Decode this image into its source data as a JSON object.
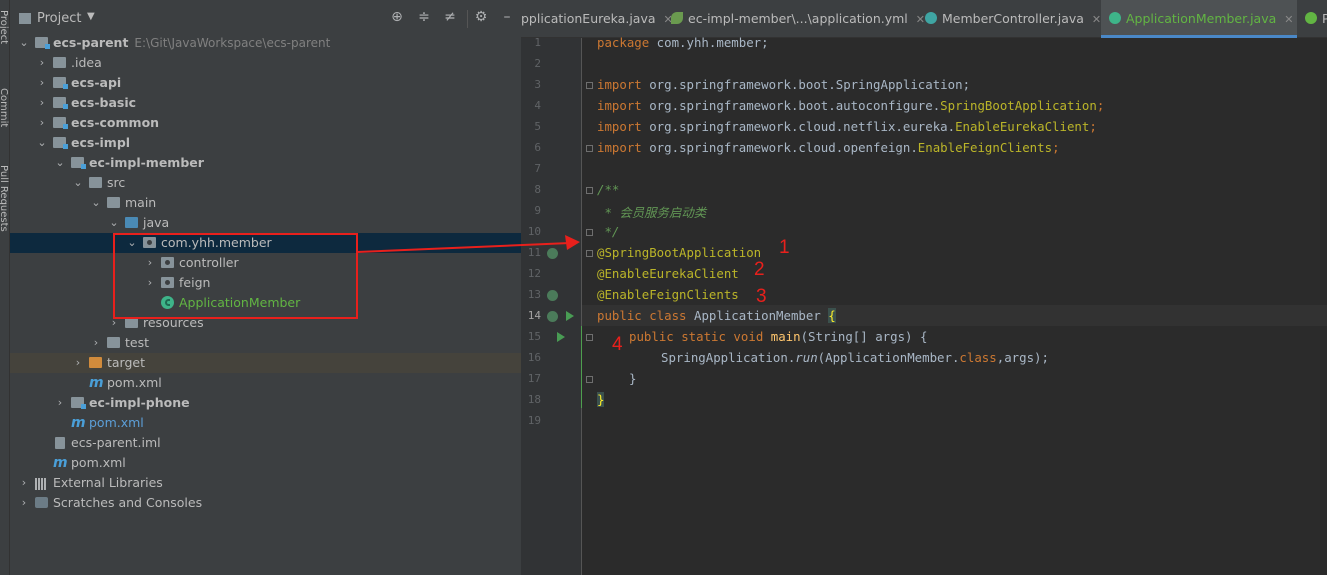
{
  "toolstrip": [
    "Project",
    "Commit",
    "Pull Requests"
  ],
  "project": {
    "title": "Project",
    "rows": [
      {
        "label": "ecs-parent",
        "path": "E:\\Git\\JavaWorkspace\\ecs-parent"
      },
      {
        "label": ".idea"
      },
      {
        "label": "ecs-api"
      },
      {
        "label": "ecs-basic"
      },
      {
        "label": "ecs-common"
      },
      {
        "label": "ecs-impl"
      },
      {
        "label": "ec-impl-member"
      },
      {
        "label": "src"
      },
      {
        "label": "main"
      },
      {
        "label": "java"
      },
      {
        "label": "com.yhh.member"
      },
      {
        "label": "controller"
      },
      {
        "label": "feign"
      },
      {
        "label": "ApplicationMember"
      },
      {
        "label": "resources"
      },
      {
        "label": "test"
      },
      {
        "label": "target"
      },
      {
        "label": "pom.xml"
      },
      {
        "label": "ec-impl-phone"
      },
      {
        "label": "pom.xml"
      },
      {
        "label": "ecs-parent.iml"
      },
      {
        "label": "pom.xml"
      },
      {
        "label": "External Libraries"
      },
      {
        "label": "Scratches and Consoles"
      }
    ]
  },
  "tabs": [
    {
      "label": "pplicationEureka.java"
    },
    {
      "label": "ec-impl-member\\...\\application.yml"
    },
    {
      "label": "MemberController.java"
    },
    {
      "label": "ApplicationMember.java"
    },
    {
      "label": "P"
    }
  ],
  "editor": {
    "line_numbers": [
      "1",
      "2",
      "3",
      "4",
      "5",
      "6",
      "7",
      "8",
      "9",
      "10",
      "11",
      "12",
      "13",
      "14",
      "15",
      "16",
      "17",
      "18",
      "19"
    ],
    "l1": {
      "kw": "package",
      "rest": " com.yhh.member;"
    },
    "imports": [
      {
        "kw": "import",
        "pre": " org.springframework.boot.",
        "cls": "SpringApplication",
        "end": ";"
      },
      {
        "kw": "import",
        "pre": " org.springframework.boot.autoconfigure.",
        "cls": "SpringBootApplication",
        "end": ";"
      },
      {
        "kw": "import",
        "pre": " org.springframework.cloud.netflix.eureka.",
        "cls": "EnableEurekaClient",
        "end": ";"
      },
      {
        "kw": "import",
        "pre": " org.springframework.cloud.openfeign.",
        "cls": "EnableFeignClients",
        "end": ";"
      }
    ],
    "doc": [
      "/**",
      " * 会员服务启动类",
      " */"
    ],
    "annotations": [
      "@SpringBootApplication",
      "@EnableEurekaClient",
      "@EnableFeignClients"
    ],
    "l14": {
      "kw": "public class",
      "name": " ApplicationMember ",
      "brace": "{"
    },
    "l15": {
      "kw": "public static void",
      "fn": "main",
      "rest": "(String[] args) {"
    },
    "l16": {
      "pre": "SpringApplication.",
      "call": "run",
      "rest": "(ApplicationMember.",
      "kw": "class",
      "end": ",args);"
    },
    "l17": "}",
    "l18": "}"
  },
  "markers": [
    "1",
    "2",
    "3",
    "4"
  ]
}
